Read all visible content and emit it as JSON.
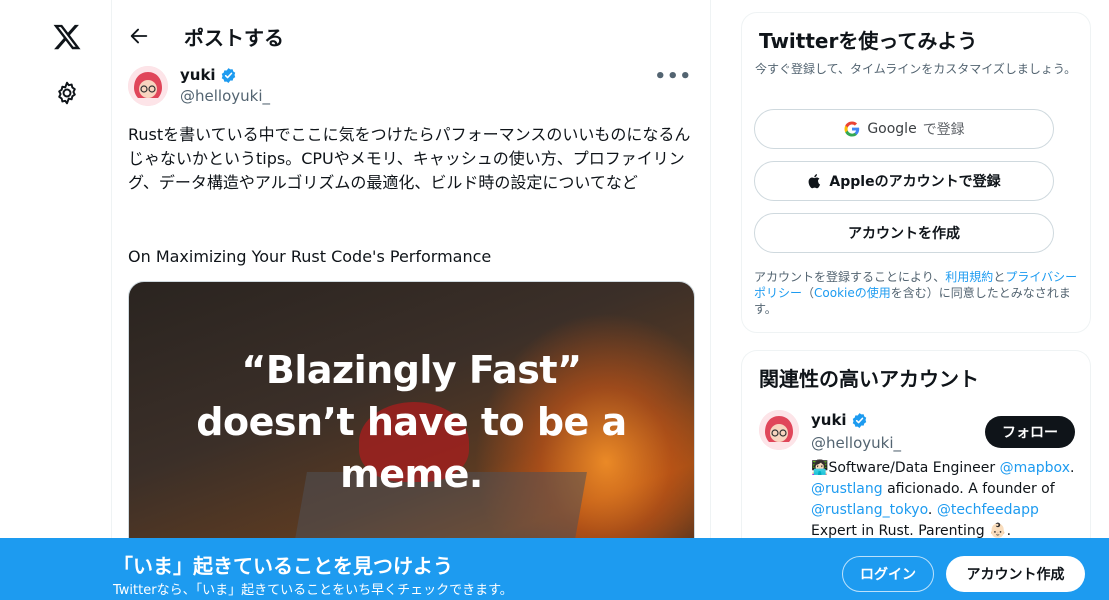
{
  "nav": {
    "logo_icon": "x-logo-icon",
    "settings_icon": "gear-icon"
  },
  "header": {
    "title": "ポストする"
  },
  "post": {
    "author_name": "yuki",
    "author_handle": "@helloyuki_",
    "text": "Rustを書いている中でここに気をつけたらパフォーマンスのいいものになるんじゃないかというtips。CPUやメモリ、キャッシュの使い方、プロファイリング、データ構造やアルゴリズムの最適化、ビルド時の設定についてなど",
    "link_title": "On Maximizing Your Rust Code's Performance",
    "media_text_line1": "“Blazingly Fast”",
    "media_text_line2": "doesn’t have to be a",
    "media_text_line3": "meme.",
    "more_label": "•••"
  },
  "signup_card": {
    "title": "Twitterを使ってみよう",
    "subtitle": "今すぐ登録して、タイムラインをカスタマイズしましょう。",
    "google_label_brand": "Google",
    "google_label_suffix": "で登録",
    "apple_label": "Appleのアカウントで登録",
    "create_label": "アカウントを作成",
    "terms_prefix": "アカウントを登録することにより、",
    "terms_link": "利用規約",
    "terms_and": "と",
    "privacy_link": "プライバシーポリシー",
    "terms_paren_open": "（",
    "cookie_link": "Cookieの使用",
    "terms_suffix": "を含む）に同意したとみなされます。"
  },
  "related_card": {
    "title": "関連性の高いアカウント",
    "name": "yuki",
    "handle": "@helloyuki_",
    "follow_label": "フォロー",
    "bio_emoji": "👩🏻‍💻",
    "bio_1": "Software/Data Engineer ",
    "bio_mention1": "@mapbox",
    "bio_2": ". ",
    "bio_mention2": "@rustlang",
    "bio_3": " aficionado. A founder of ",
    "bio_mention3": "@rustlang_tokyo",
    "bio_4": ". ",
    "bio_mention4": "@techfeedapp",
    "bio_5": " Expert in Rust. Parenting ",
    "bio_emoji2": "👶🏻",
    "bio_6": "."
  },
  "bottom_bar": {
    "title": "「いま」起きていることを見つけよう",
    "subtitle": "Twitterなら、「いま」起きていることをいち早くチェックできます。",
    "login_label": "ログイン",
    "signup_label": "アカウント作成"
  },
  "colors": {
    "accent": "#1d9bf0",
    "text": "#0f1419",
    "muted": "#536471"
  }
}
